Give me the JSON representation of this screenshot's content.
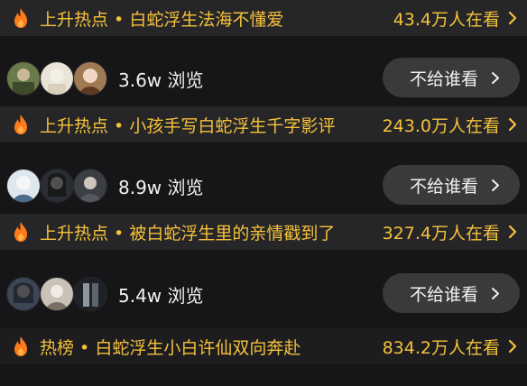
{
  "feed": [
    {
      "trend": {
        "prefix": "上升热点",
        "separator": " • ",
        "topic": "白蛇浮生法海不懂爱",
        "views": "43.4万人在看"
      }
    },
    {
      "post": {
        "views": "3.6w 浏览",
        "button": "不给谁看"
      },
      "trend": {
        "prefix": "上升热点",
        "separator": " • ",
        "topic": "小孩手写白蛇浮生千字影评",
        "views": "243.0万人在看"
      }
    },
    {
      "post": {
        "views": "8.9w 浏览",
        "button": "不给谁看"
      },
      "trend": {
        "prefix": "上升热点",
        "separator": " • ",
        "topic": "被白蛇浮生里的亲情戳到了",
        "views": "327.4万人在看"
      }
    },
    {
      "post": {
        "views": "5.4w 浏览",
        "button": "不给谁看"
      },
      "trend": {
        "prefix": "热榜",
        "separator": " • ",
        "topic": "白蛇浮生小白许仙双向奔赴",
        "views": "834.2万人在看"
      }
    }
  ],
  "colors": {
    "accent": "#f6c23a",
    "flame": "#ff7a1a",
    "button_bg": "#3a3a3d",
    "trend_bg": "#262629",
    "page_bg": "#161618"
  },
  "icons": {
    "flame": "flame-icon",
    "chevron": "chevron-right-icon"
  }
}
